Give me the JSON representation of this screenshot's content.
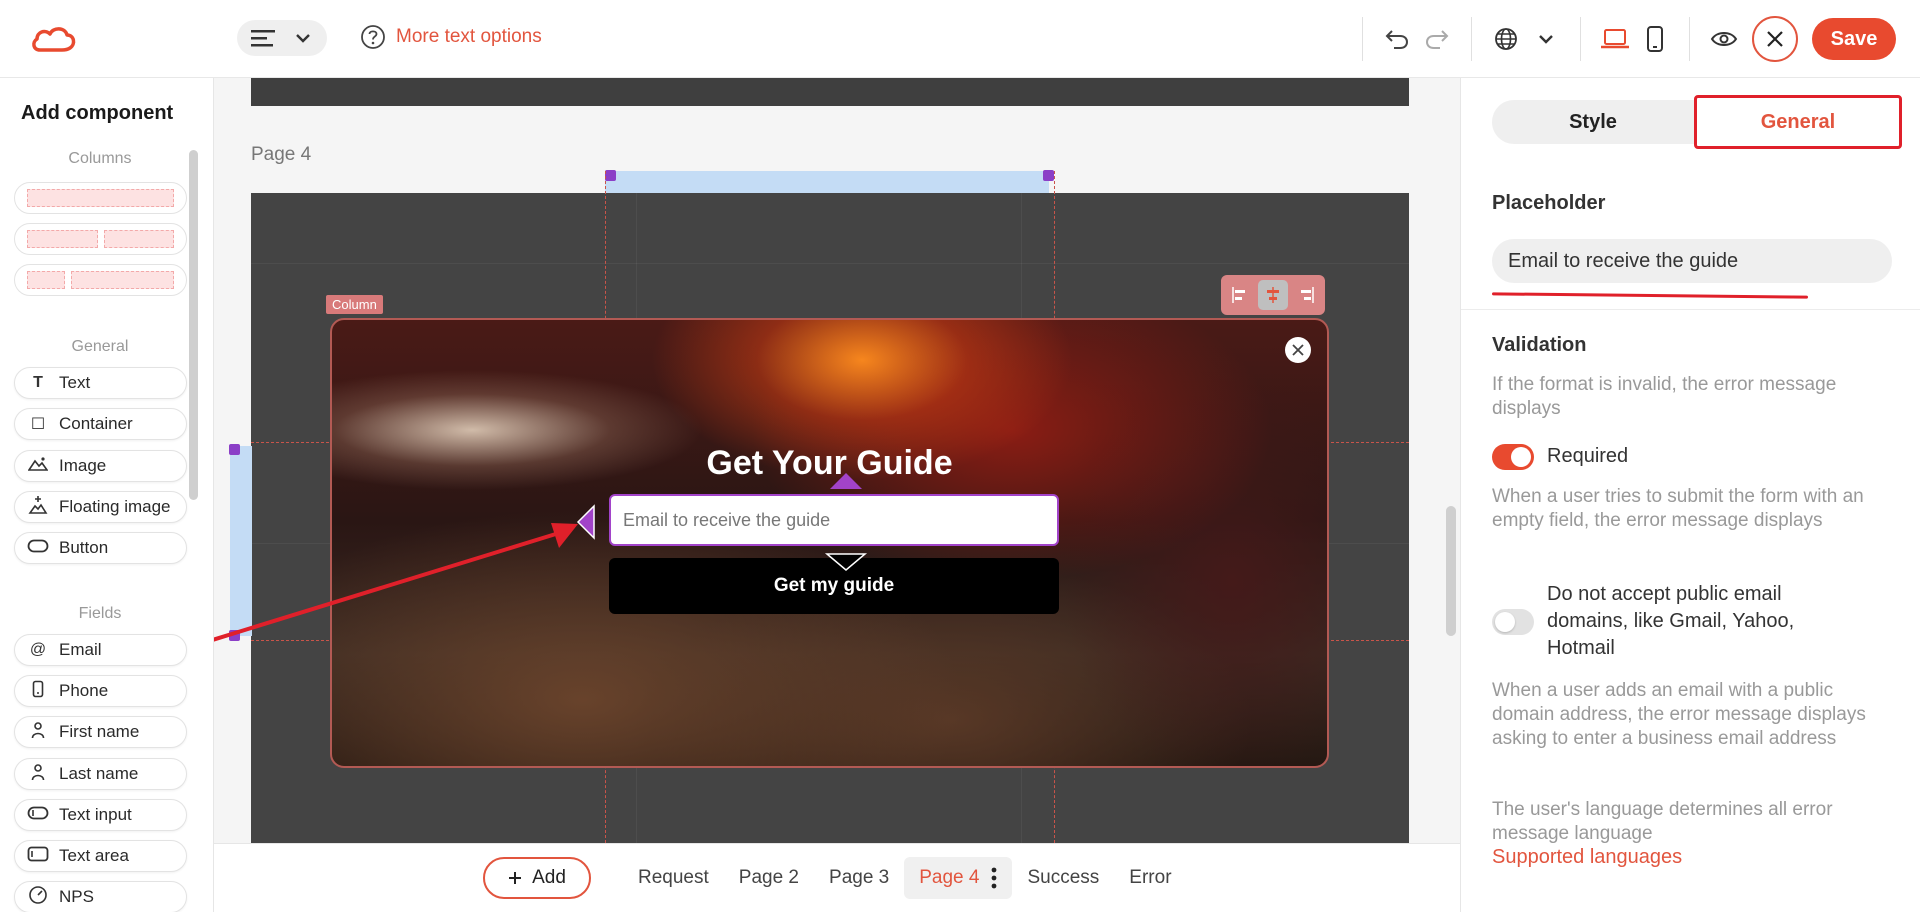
{
  "topbar": {
    "more_text_options": "More text options",
    "save_label": "Save"
  },
  "sidebar": {
    "title": "Add component",
    "sections": {
      "columns": "Columns",
      "general": "General",
      "fields": "Fields"
    },
    "general_items": [
      {
        "label": "Text",
        "icon": "text-icon"
      },
      {
        "label": "Container",
        "icon": "square-icon"
      },
      {
        "label": "Image",
        "icon": "image-icon"
      },
      {
        "label": "Floating image",
        "icon": "floating-image-icon"
      },
      {
        "label": "Button",
        "icon": "button-icon"
      }
    ],
    "field_items": [
      {
        "label": "Email",
        "icon": "at-icon"
      },
      {
        "label": "Phone",
        "icon": "phone-icon"
      },
      {
        "label": "First name",
        "icon": "person-icon"
      },
      {
        "label": "Last name",
        "icon": "person-icon"
      },
      {
        "label": "Text input",
        "icon": "text-input-icon"
      },
      {
        "label": "Text area",
        "icon": "text-area-icon"
      },
      {
        "label": "NPS",
        "icon": "gauge-icon"
      }
    ]
  },
  "canvas": {
    "page_label": "Page 4",
    "column_tag": "Column",
    "popup": {
      "title": "Get Your Guide",
      "email_placeholder": "Email to receive the guide",
      "button_label": "Get my guide"
    }
  },
  "bottombar": {
    "add_label": "Add",
    "pages": [
      "Request",
      "Page 2",
      "Page 3",
      "Page 4",
      "Success",
      "Error"
    ],
    "active_page": "Page 4"
  },
  "panel": {
    "tabs": [
      "Style",
      "General"
    ],
    "active_tab": "General",
    "placeholder_heading": "Placeholder",
    "placeholder_value": "Email to receive the guide",
    "validation_heading": "Validation",
    "validation_desc": "If the format is invalid, the error message displays",
    "required_label": "Required",
    "required_on": true,
    "required_desc": "When a user tries to submit the form with an empty field, the error message displays",
    "public_domains_label": "Do not accept public email domains, like Gmail, Yahoo, Hotmail",
    "public_domains_on": false,
    "public_domains_desc": "When a user adds an email with a public domain address, the error message displays asking to enter a business email address",
    "language_desc": "The user's language determines all error message language",
    "supported_languages_link": "Supported languages"
  },
  "colors": {
    "accent": "#e84a2f",
    "accent_text": "#e2553e",
    "selection_purple": "#a243c9",
    "annotation_red": "#e0202a"
  }
}
